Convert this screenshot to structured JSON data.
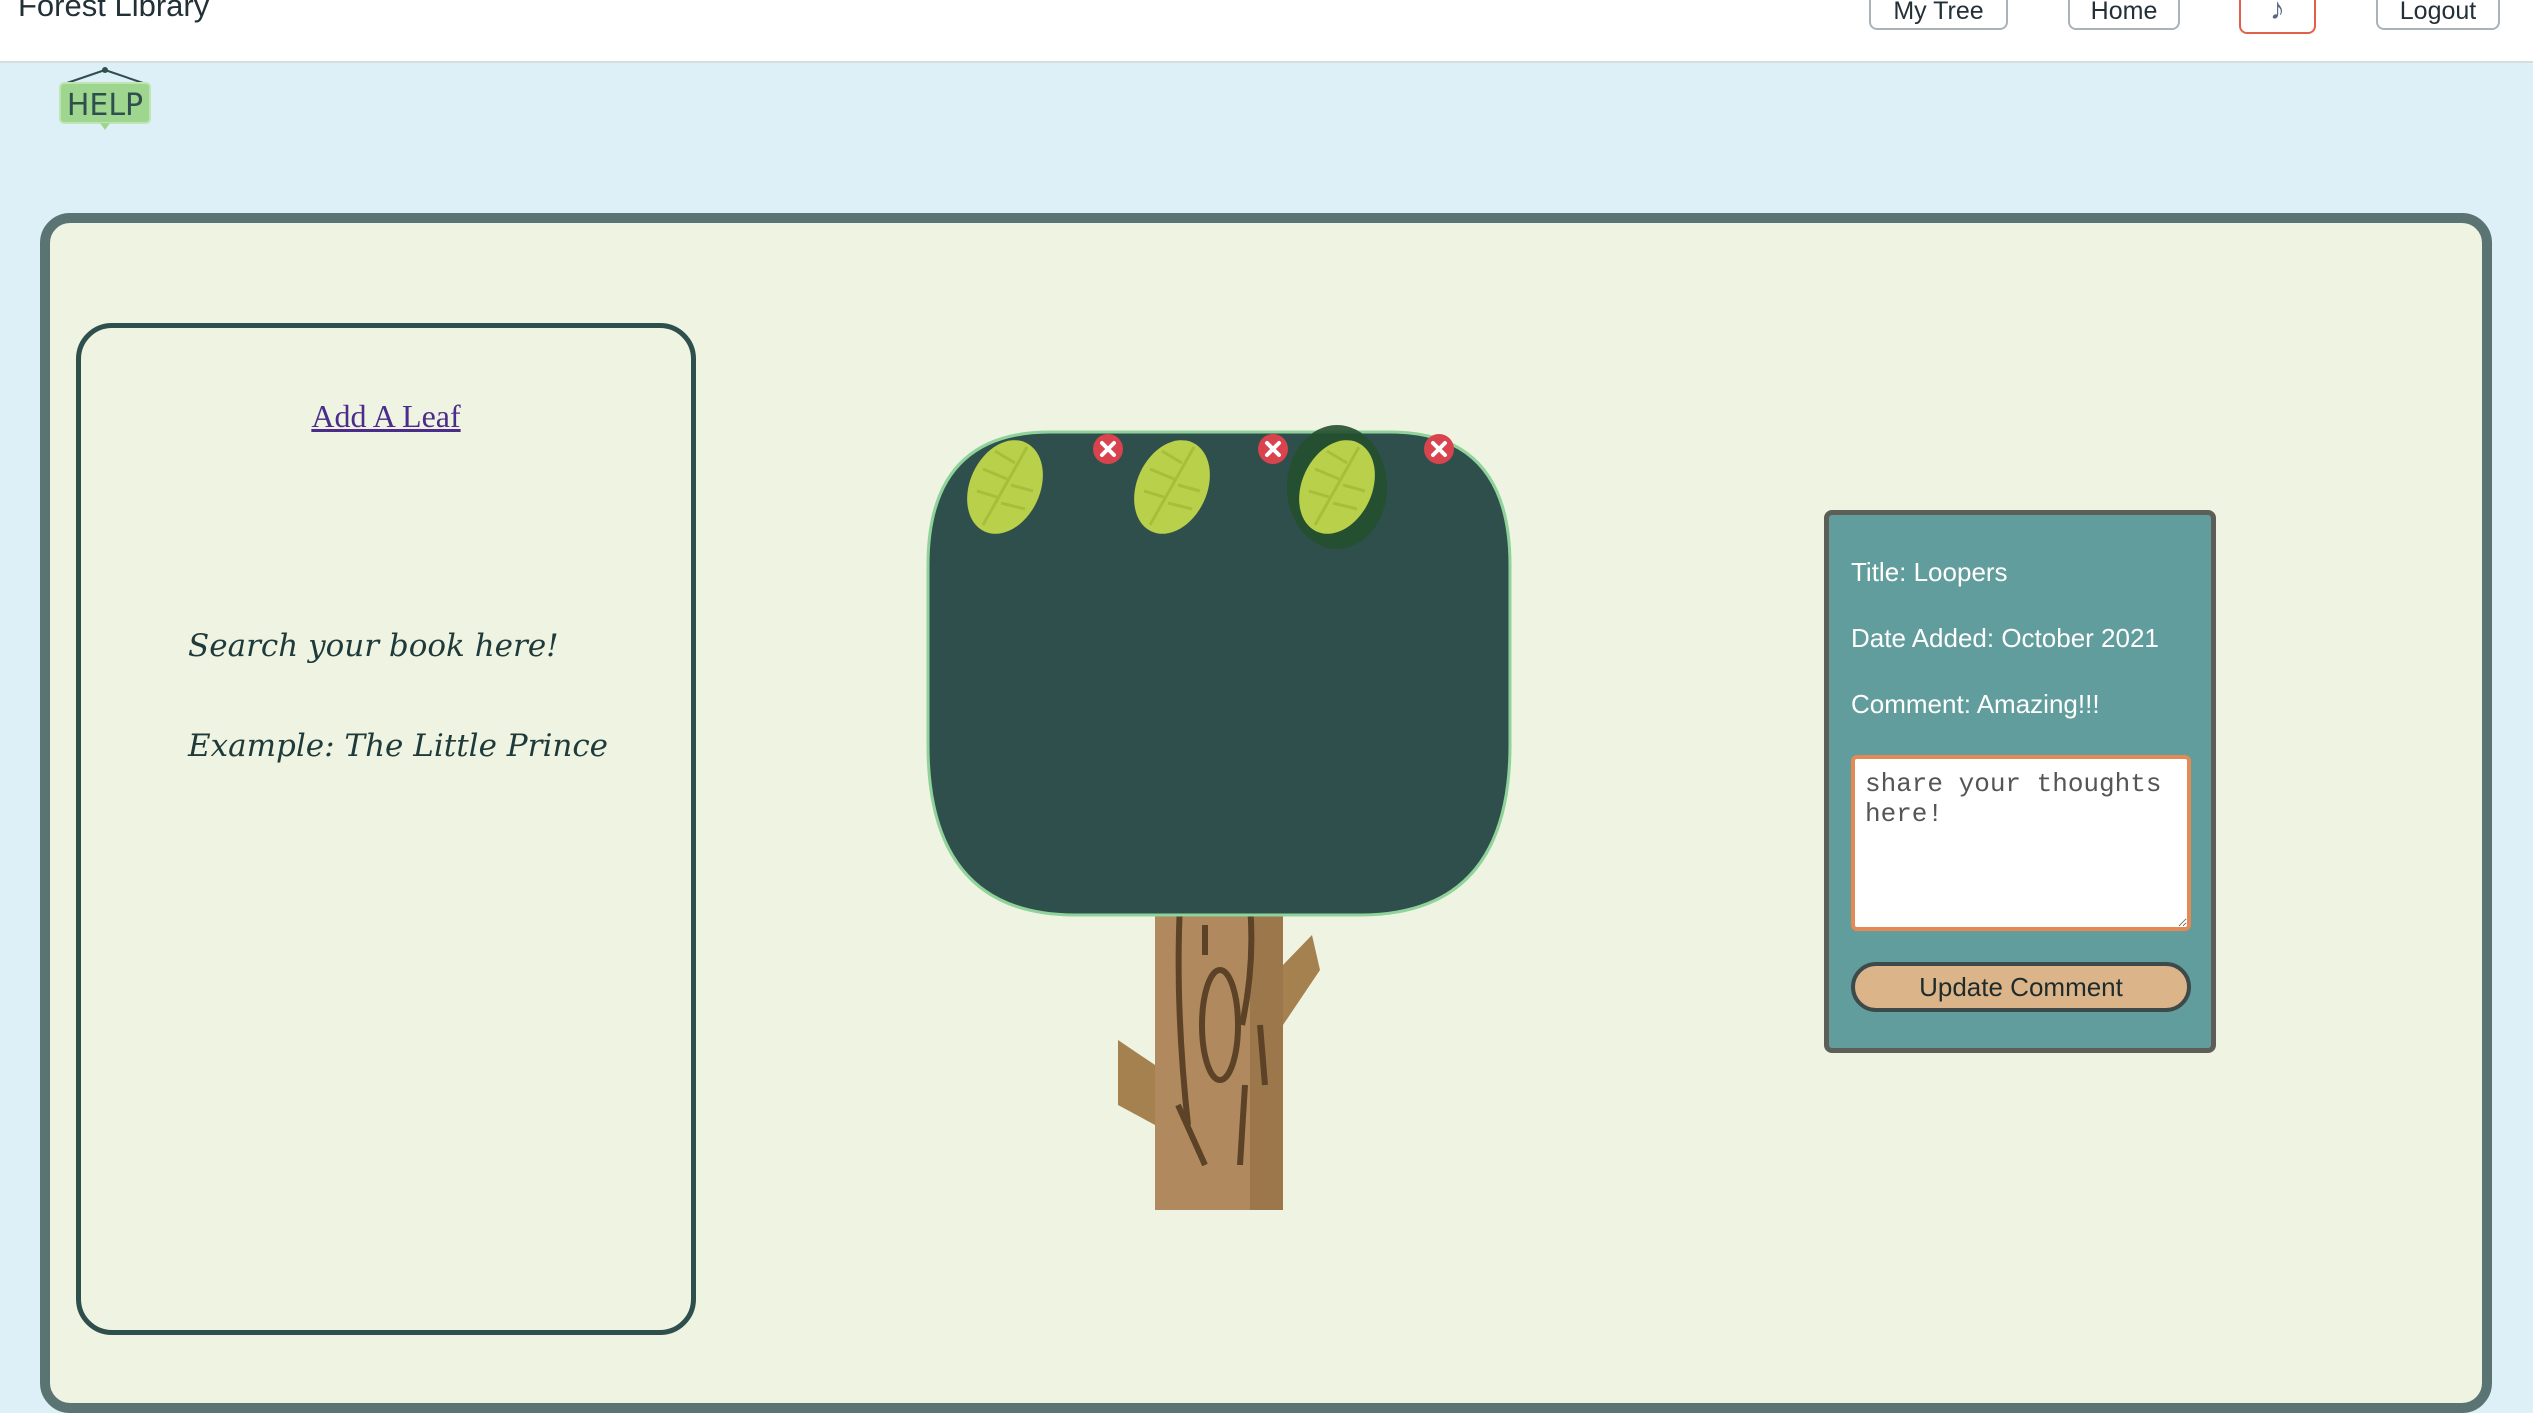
{
  "app": {
    "title": "Forest Library"
  },
  "nav": {
    "my_tree": "My Tree",
    "home": "Home",
    "music_icon": "music-note-icon",
    "logout": "Logout"
  },
  "help": {
    "label": "HELP"
  },
  "left_panel": {
    "add_leaf": "Add A Leaf",
    "search_hint": "Search your book here!",
    "example_hint": "Example: The Little Prince"
  },
  "tree": {
    "leaves": [
      {
        "label": "leaf-1",
        "selected": false
      },
      {
        "label": "leaf-2",
        "selected": false
      },
      {
        "label": "leaf-3",
        "selected": true
      }
    ],
    "canopy_color": "#2f4f4d",
    "leaf_color": "#b9d04a",
    "delete_color": "#d9434e"
  },
  "info_card": {
    "title": "Title: Loopers",
    "date": "Date Added: October 2021",
    "comment": "Comment: Amazing!!!",
    "textarea_placeholder": "share your thoughts here!",
    "update_button": "Update Comment"
  },
  "colors": {
    "page_bg": "#ddf0f7",
    "panel_bg": "#eef3e2",
    "frame_border": "#5a7474",
    "card_bg": "#619d9d",
    "button_bg": "#dcb48a"
  }
}
